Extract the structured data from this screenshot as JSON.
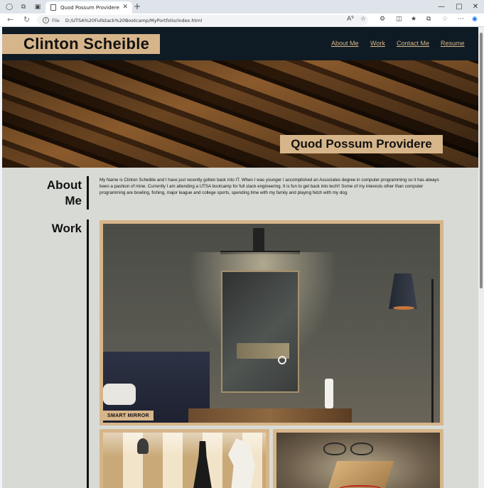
{
  "browser": {
    "tab_title": "Quod Possum Providere",
    "url_prefix": "File",
    "url": "D:/UTSA%20Fullstack%20Bootcamp/MyPortfolio/index.html"
  },
  "header": {
    "name": "Clinton Scheible",
    "nav": [
      "About Me",
      "Work",
      "Contact Me",
      "Resume"
    ]
  },
  "hero": {
    "title": "Quod Possum Providere"
  },
  "about": {
    "heading_line1": "About",
    "heading_line2": "Me",
    "text": "My Name is Clinton Scheible and I have just recently gotten back into IT. When I was younger I accomplished an Associates degree in computer programming so it has always been a pashion of mine. Currently I am attending a UTSA bootcamp for full stack engineering. It is fun to get back into tech!! Some of my interests other than computer programming are bowling, fishing, major league and college sports, spending time with my family and playing fetch with my dog."
  },
  "work": {
    "heading": "Work",
    "projects": [
      {
        "label": "SMART MIRROR"
      }
    ]
  },
  "colors": {
    "accent": "#d7b58a",
    "header_bg": "#0f1b24",
    "page_bg": "#d8dbd5"
  }
}
